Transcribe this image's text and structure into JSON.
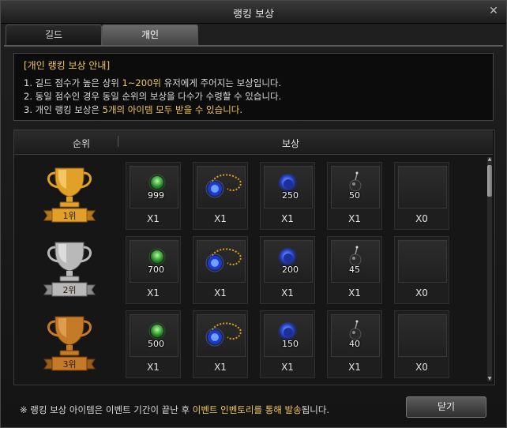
{
  "window": {
    "title": "랭킹 보상"
  },
  "tabs": [
    {
      "label": "길드"
    },
    {
      "label": "개인"
    }
  ],
  "notice": {
    "head": "[개인 랭킹 보상 안내]",
    "lines": [
      {
        "a": "1. 길드 점수가 높은 상위 ",
        "b": "1~200위",
        "c": " 유저에게 주어지는 보상입니다."
      },
      {
        "a": "2. 동일 점수인 경우 동일 순위의 보상을 다수가 수령할 수 있습니다.",
        "b": "",
        "c": ""
      },
      {
        "a": "3. 개인 랭킹 보상은 ",
        "b": "5개의 아이템 모두 받을 수 있습니다",
        "c": "."
      }
    ]
  },
  "table": {
    "header_rank": "순위",
    "header_reward": "보상",
    "rows": [
      {
        "rank": "1위",
        "trophy": "gold-trophy",
        "slots": [
          {
            "icon": "green-gem-icon",
            "count": "999",
            "qty": "X1"
          },
          {
            "icon": "blue-necklace-icon",
            "count": "",
            "qty": "X1"
          },
          {
            "icon": "blue-orb-icon",
            "count": "250",
            "qty": "X1"
          },
          {
            "icon": "black-bomb-icon",
            "count": "50",
            "qty": "X1"
          },
          {
            "icon": "",
            "count": "",
            "qty": "X0"
          }
        ]
      },
      {
        "rank": "2위",
        "trophy": "silver-trophy",
        "slots": [
          {
            "icon": "green-gem-icon",
            "count": "700",
            "qty": "X1"
          },
          {
            "icon": "blue-necklace-icon",
            "count": "",
            "qty": "X1"
          },
          {
            "icon": "blue-orb-icon",
            "count": "200",
            "qty": "X1"
          },
          {
            "icon": "black-bomb-icon",
            "count": "45",
            "qty": "X1"
          },
          {
            "icon": "",
            "count": "",
            "qty": "X0"
          }
        ]
      },
      {
        "rank": "3위",
        "trophy": "bronze-trophy",
        "slots": [
          {
            "icon": "green-gem-icon",
            "count": "500",
            "qty": "X1"
          },
          {
            "icon": "blue-necklace-icon",
            "count": "",
            "qty": "X1"
          },
          {
            "icon": "blue-orb-icon",
            "count": "150",
            "qty": "X1"
          },
          {
            "icon": "black-bomb-icon",
            "count": "40",
            "qty": "X1"
          },
          {
            "icon": "",
            "count": "",
            "qty": "X0"
          }
        ]
      }
    ]
  },
  "footer": {
    "note_a": "※ 랭킹 보상 아이템은 이벤트 기간이 끝난 후 ",
    "note_b": "이벤트 인벤토리를 통해 발송",
    "note_c": "됩니다.",
    "close_label": "닫기"
  },
  "colors": {
    "highlight": "#f1c85a",
    "gold": "#d9921f",
    "silver": "#bfbfbf",
    "bronze": "#c9781f"
  }
}
